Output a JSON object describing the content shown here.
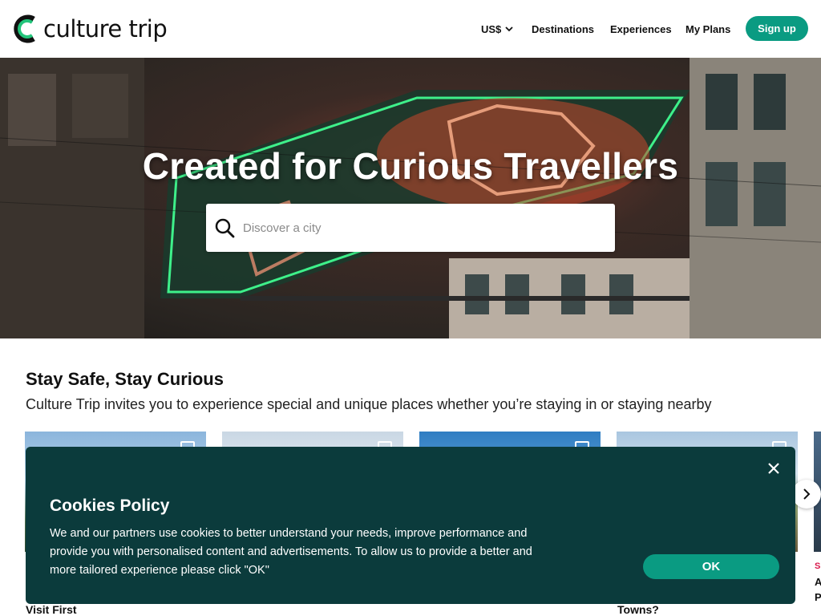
{
  "header": {
    "logo_text": "culture trip",
    "currency": "US$",
    "nav": [
      "Destinations",
      "Experiences",
      "My Plans"
    ],
    "signup_label": "Sign up"
  },
  "hero": {
    "title": "Created for Curious Travellers",
    "search_placeholder": "Discover a city"
  },
  "section": {
    "title": "Stay Safe, Stay Curious",
    "subtitle": "Culture Trip invites you to experience special and unique places whether you’re staying in or staying nearby",
    "card_labels": [
      "Visit First",
      "Towns?"
    ],
    "side_tag": "SI",
    "side_a": "A",
    "side_p": "P"
  },
  "cookies": {
    "title": "Cookies Policy",
    "lines": [
      "We and our partners use cookies to better understand your needs, improve performance and",
      "provide you with personalised content and advertisements. To allow us to provide a better and",
      "more tailored experience please click \"OK\""
    ],
    "ok_label": "OK"
  },
  "colors": {
    "accent": "#0a9b82",
    "banner": "#0b3b3c"
  },
  "icons": [
    "culture-trip-logo-icon",
    "chevron-down-icon",
    "search-icon",
    "bookmark-icon",
    "chevron-right-icon",
    "close-icon"
  ]
}
